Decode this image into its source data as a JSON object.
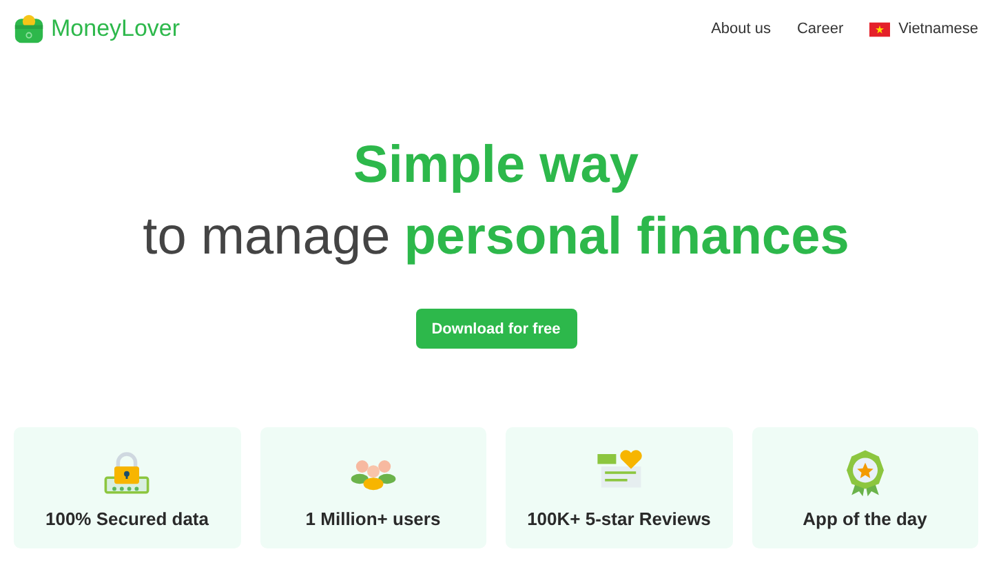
{
  "header": {
    "logo": "MoneyLover",
    "nav": [
      {
        "label": "About us"
      },
      {
        "label": "Career"
      }
    ],
    "language": {
      "label": "Vietnamese"
    }
  },
  "hero": {
    "title": "Simple way",
    "subtitle_plain": "to manage",
    "subtitle_highlight": "personal finances",
    "button": "Download for free"
  },
  "features": [
    {
      "kind": "lock",
      "label": "100% Secured data"
    },
    {
      "kind": "users",
      "label": "1 Million+ users"
    },
    {
      "kind": "reviews",
      "label": "100K+ 5-star Reviews"
    },
    {
      "kind": "award",
      "label": "App of the day"
    }
  ]
}
